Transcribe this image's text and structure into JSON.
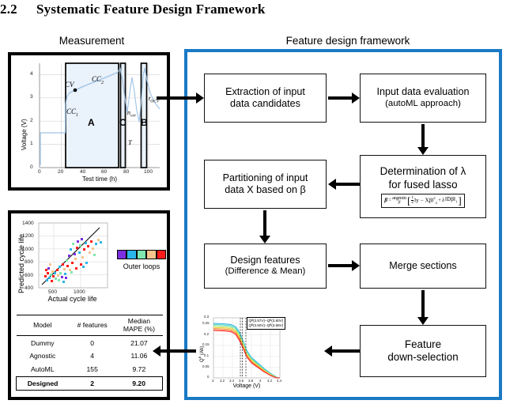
{
  "section": {
    "number": "2.2",
    "title": "Systematic Feature Design Framework"
  },
  "captions": {
    "measurement": "Measurement",
    "framework": "Feature design framework"
  },
  "colors": {
    "framework_border": "#1a7ac4",
    "panel_border": "#000000",
    "curve": "#9dc3e6",
    "region_fill": "#eaf2fb"
  },
  "flow": {
    "extraction": {
      "line1": "Extraction of input",
      "line2": "data candidates"
    },
    "evaluation": {
      "line1": "Input data evaluation",
      "line2": "(autoML approach)"
    },
    "lambda": {
      "line1": "Determination of λ",
      "line2": "for fused lasso"
    },
    "partition": {
      "line1": "Partitioning of input",
      "line2": "data X based on β"
    },
    "design": {
      "line1": "Design features",
      "line2": "(Difference & Mean)"
    },
    "merge": {
      "line1": "Merge sections"
    },
    "downselection": {
      "line1": "Feature",
      "line2": "down-selection"
    }
  },
  "formula": {
    "lhs": "β",
    "equals": "=",
    "operator": "argmin",
    "operator_sub": "β",
    "frac_num": "1",
    "frac_den": "2",
    "term1": "‖y − Xβ‖",
    "term1_sup": "2",
    "term1_sub": "2",
    "plus": "+",
    "term2_lambda": "λ",
    "term2": "‖Dβ‖",
    "term2_sub": "1"
  },
  "chart_data": [
    {
      "type": "line",
      "name": "voltage-protocol",
      "title": "",
      "xlabel": "Test time (h)",
      "ylabel": "Voltage (V)",
      "xlim": [
        -5,
        105
      ],
      "ylim": [
        0,
        4.5
      ],
      "xticks": [
        0,
        20,
        40,
        60,
        80,
        100
      ],
      "yticks": [
        0,
        1,
        2,
        3,
        4
      ],
      "annotations": [
        {
          "text": "CC₁",
          "x": 27,
          "y": 2.75
        },
        {
          "text": "CV",
          "x": 30,
          "y": 3.85
        },
        {
          "text": "CC₂",
          "x": 58,
          "y": 4.25
        },
        {
          "text": "A",
          "x": 47,
          "y": 2.2
        },
        {
          "text": "C",
          "x": 74.5,
          "y": 2.2
        },
        {
          "text": "B",
          "x": 94,
          "y": 2.2
        },
        {
          "text": "n_ver",
          "x": 82,
          "y": 2.5
        },
        {
          "text": "T",
          "x": 82,
          "y": 1.05
        },
        {
          "text": "t_OCV",
          "x": 99,
          "y": 3.0
        }
      ],
      "regions": [
        {
          "label": "A",
          "x_start": 24,
          "x_end": 73
        },
        {
          "label": "C",
          "x_start": 73.5,
          "x_end": 76.5
        },
        {
          "label": "B",
          "x_start": 92.5,
          "x_end": 96
        }
      ],
      "marker_point": {
        "x": 30,
        "y": 3.65,
        "label": "CV"
      }
    },
    {
      "type": "scatter",
      "name": "predicted-vs-actual-cycle-life",
      "title": "",
      "xlabel": "Actual cycle life",
      "ylabel": "Predicted cycle life",
      "xlim": [
        330,
        1450
      ],
      "ylim": [
        400,
        1450
      ],
      "xticks": [
        500,
        1000
      ],
      "yticks": [
        400,
        600,
        800,
        1000,
        1200,
        1400
      ],
      "grid": true,
      "reference_line": "y = x",
      "legend": {
        "label": "Outer loops",
        "colors": [
          "#7b2fe0",
          "#29b6e8",
          "#7fe8b0",
          "#f5c48c",
          "#ff1a1a"
        ]
      }
    },
    {
      "type": "line",
      "name": "capacity-voltage-curves",
      "title": "",
      "xlabel": "Voltage (V)",
      "ylabel": "Qᴮ (Ah)",
      "xlim": [
        3.0,
        4.4
      ],
      "ylim": [
        0,
        0.3
      ],
      "xticks": [
        3,
        3.2,
        3.4,
        3.6,
        3.8,
        4,
        4.2,
        4.4
      ],
      "yticks": [
        0,
        0.05,
        0.1,
        0.15,
        0.2,
        0.25,
        0.3
      ],
      "vertical_markers": [
        3.57,
        3.6,
        3.66
      ],
      "annotation_lines": [
        "Qᴮ(3.57V)−Qᴮ(3.60V)",
        "Qᴮ(3.60V)−Qᴮ(3.66V)"
      ]
    },
    {
      "type": "table",
      "name": "model-comparison",
      "columns": [
        "Model",
        "# features",
        "Median MAPE (%)"
      ],
      "rows": [
        {
          "model": "Dummy",
          "features": "0",
          "mape": "21.07",
          "highlight": false
        },
        {
          "model": "Agnostic",
          "features": "4",
          "mape": "11.06",
          "highlight": false
        },
        {
          "model": "AutoML",
          "features": "155",
          "mape": "9.72",
          "highlight": false
        },
        {
          "model": "Designed",
          "features": "2",
          "mape": "9.20",
          "highlight": true
        }
      ]
    }
  ],
  "table": {
    "headers": {
      "model": "Model",
      "features": "# features",
      "mape_l1": "Median",
      "mape_l2": "MAPE (%)"
    },
    "rows": [
      {
        "model": "Dummy",
        "features": "0",
        "mape": "21.07"
      },
      {
        "model": "Agnostic",
        "features": "4",
        "mape": "11.06"
      },
      {
        "model": "AutoML",
        "features": "155",
        "mape": "9.72"
      },
      {
        "model": "Designed",
        "features": "2",
        "mape": "9.20"
      }
    ]
  },
  "voltage_plot": {
    "xlabel": "Test time (h)",
    "ylabel": "Voltage (V)",
    "xticks": [
      "0",
      "20",
      "40",
      "60",
      "80",
      "100"
    ],
    "yticks": [
      "0",
      "1",
      "2",
      "3",
      "4"
    ],
    "labels": {
      "cc1": "CC",
      "cc1_sub": "1",
      "cc2": "CC",
      "cc2_sub": "2",
      "cv": "CV",
      "region_a": "A",
      "region_b": "B",
      "region_c": "C",
      "nver": "n",
      "nver_sub": "ver",
      "temp": "T",
      "tocv": "t",
      "tocv_sub": "OCV"
    }
  },
  "scatter_plot": {
    "xlabel": "Actual cycle life",
    "ylabel": "Predicted cycle life",
    "xticks": [
      "500",
      "1000"
    ],
    "yticks": [
      "400",
      "600",
      "800",
      "1000",
      "1200",
      "1400"
    ],
    "legend_label": "Outer loops"
  },
  "qv_plot": {
    "xlabel": "Voltage (V)",
    "ylabel_main": "Q",
    "ylabel_sup": "B",
    "ylabel_unit": " (Ah)",
    "xticks": [
      "3",
      "3.2",
      "3.4",
      "3.6",
      "3.8",
      "4",
      "4.2",
      "4.4"
    ],
    "yticks": [
      "0",
      "0.05",
      "0.1",
      "0.15",
      "0.2",
      "0.25",
      "0.3"
    ],
    "annot_line1": "Qᴮ(3.57V)−Qᴮ(3.60V)",
    "annot_line2": "Qᴮ(3.60V)−Qᴮ(3.66V)"
  }
}
